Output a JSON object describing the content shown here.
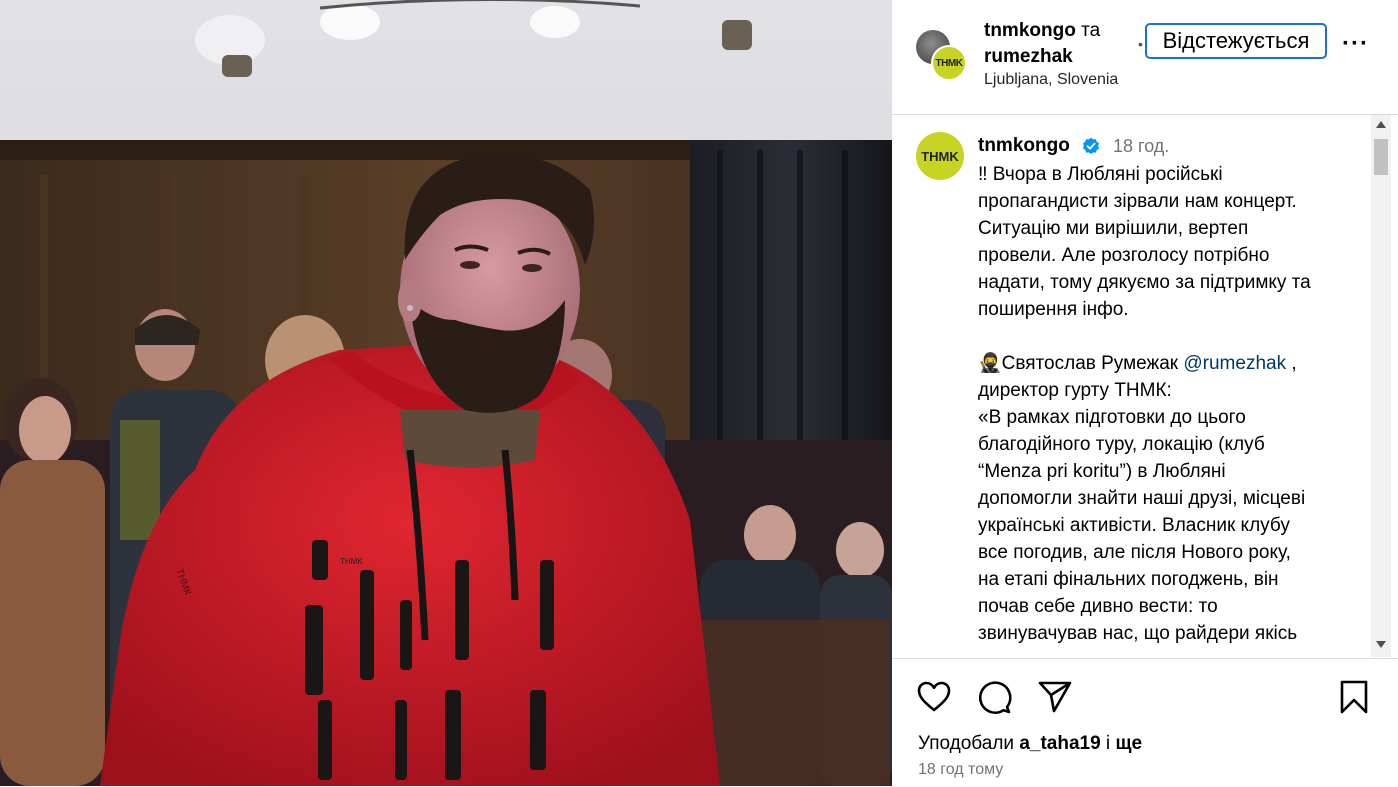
{
  "header": {
    "user1": "tnmkongo",
    "connector": "та",
    "user2": "rumezhak",
    "location": "Ljubljana, Slovenia",
    "follow_label": "Відстежується",
    "more_label": "···",
    "avatar_text": "THMK"
  },
  "caption": {
    "avatar_text": "THMK",
    "username": "tnmkongo",
    "time": "18 год.",
    "para1": "‼ Вчора в Любляні російські\nпропагандисти зірвали нам концерт.\nСитуацію ми вирішили, вертеп\nпровели. Але розголосу потрібно\nнадати, тому дякуємо за підтримку та\nпоширення інфо.",
    "line2_prefix": "🥷Святослав Румежак ",
    "line2_mention": "@rumezhak",
    "line2_suffix": " ,",
    "para2": "директор гурту ТНМК:\n«В рамках підготовки до цього\nблагодійного туру, локацію (клуб\n“Menza pri koritu”) в Любляні\nдопомогли знайти наші друзі, місцеві\nукраїнські активісти. Власник клубу\nвсе погодив, але після Нового року,\nна етапі фінальних погоджень, він\nпочав себе дивно вести: то\nзвинувачував нас, що райдери якісь"
  },
  "actions": {
    "like_icon": "heart-icon",
    "comment_icon": "comment-icon",
    "share_icon": "send-icon",
    "save_icon": "bookmark-icon",
    "likes_prefix": "Уподобали ",
    "likes_user": "a_taha19",
    "likes_suffix": " і ",
    "likes_more": "ще",
    "time_ago": "18 год тому"
  },
  "photo": {
    "hoodie_logo": "THMK",
    "hoodie_sleeve_text": "ТНМК"
  },
  "colors": {
    "brand_lime": "#c8d424",
    "follow_border": "#1f6fd6",
    "mention": "#00376b",
    "verified": "#0095f6",
    "muted": "#737373"
  }
}
